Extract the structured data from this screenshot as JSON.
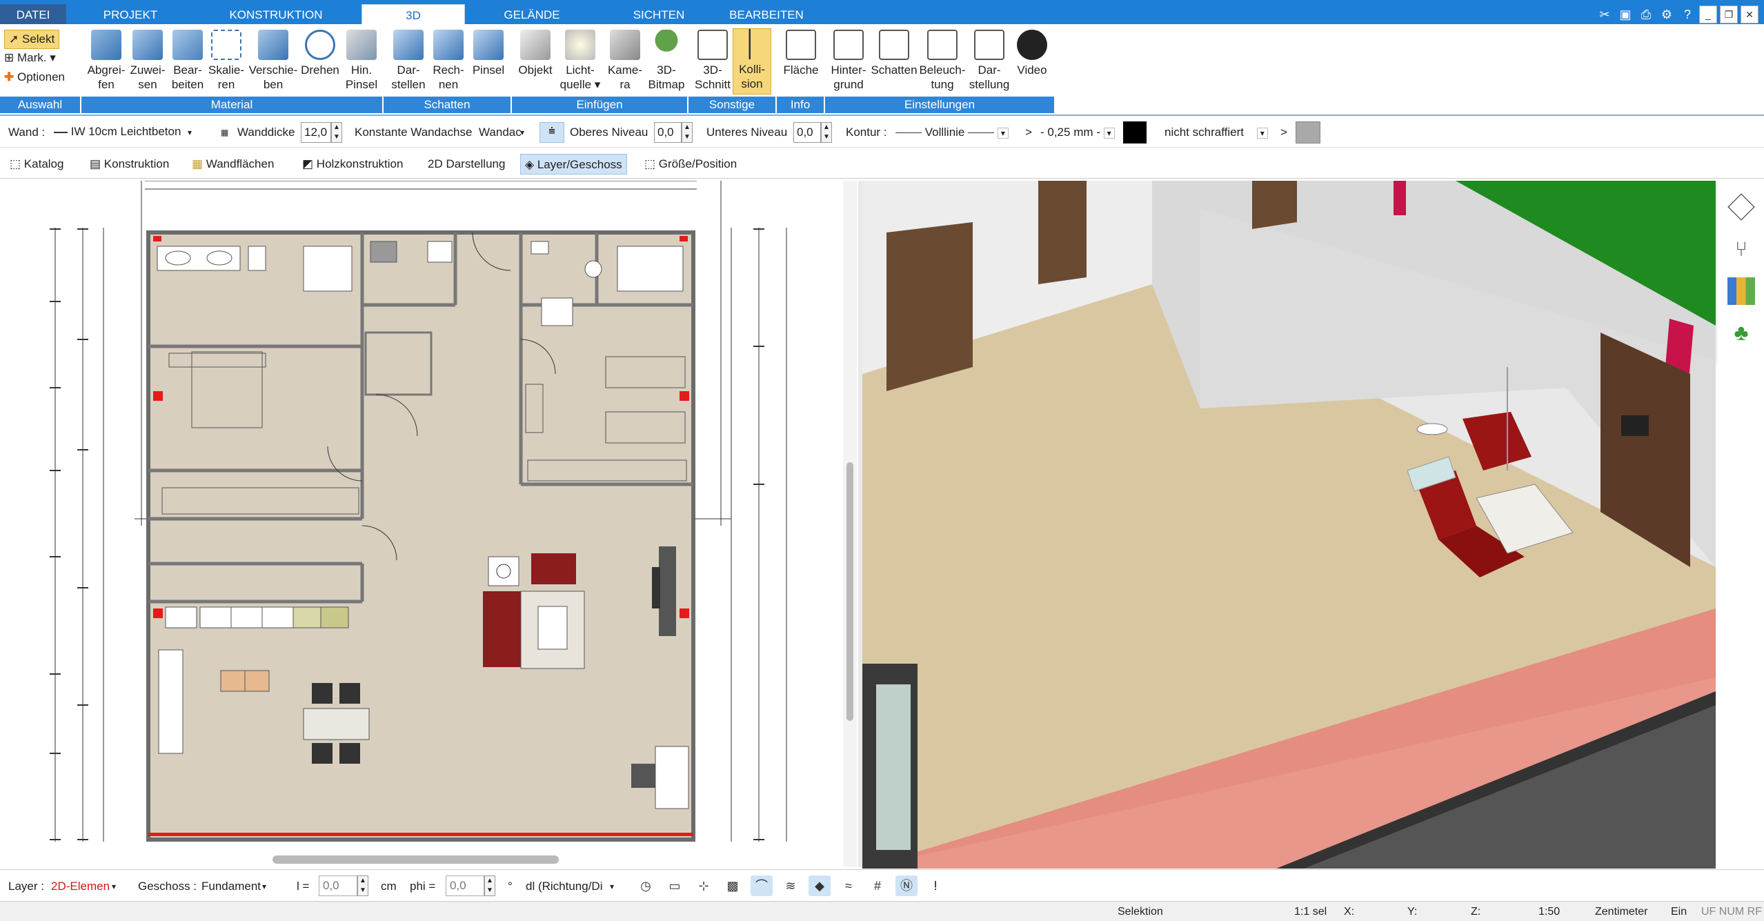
{
  "tabs": {
    "file": "DATEI",
    "items": [
      "PROJEKT",
      "KONSTRUKTION",
      "3D",
      "GELÄNDE",
      "SICHTEN",
      "BEARBEITEN"
    ],
    "active": "3D"
  },
  "window_buttons": [
    "_",
    "❐",
    "✕"
  ],
  "ribbon": {
    "auswahl": {
      "select": "Selekt",
      "mark": "Mark.",
      "options": "Optionen"
    },
    "buttons": [
      {
        "l1": "Abgrei-",
        "l2": "fen"
      },
      {
        "l1": "Zuwei-",
        "l2": "sen"
      },
      {
        "l1": "Bear-",
        "l2": "beiten"
      },
      {
        "l1": "Skalie-",
        "l2": "ren"
      },
      {
        "l1": "Verschie-",
        "l2": "ben"
      },
      {
        "l1": "Drehen",
        "l2": ""
      },
      {
        "l1": "Hin.",
        "l2": "Pinsel"
      },
      {
        "l1": "Dar-",
        "l2": "stellen"
      },
      {
        "l1": "Rech-",
        "l2": "nen"
      },
      {
        "l1": "Pinsel",
        "l2": ""
      },
      {
        "l1": "Objekt",
        "l2": ""
      },
      {
        "l1": "Licht-",
        "l2": "quelle ▾"
      },
      {
        "l1": "Kame-",
        "l2": "ra"
      },
      {
        "l1": "3D-",
        "l2": "Bitmap"
      },
      {
        "l1": "3D-",
        "l2": "Schnitt"
      },
      {
        "l1": "Kolli-",
        "l2": "sion"
      },
      {
        "l1": "Fläche",
        "l2": ""
      },
      {
        "l1": "Hinter-",
        "l2": "grund"
      },
      {
        "l1": "Schatten",
        "l2": ""
      },
      {
        "l1": "Beleuch-",
        "l2": "tung"
      },
      {
        "l1": "Dar-",
        "l2": "stellung"
      },
      {
        "l1": "Video",
        "l2": ""
      }
    ],
    "groups": [
      "Auswahl",
      "Material",
      "Schatten",
      "Einfügen",
      "Sonstige",
      "Info",
      "Einstellungen"
    ]
  },
  "props": {
    "wand_label": "Wand :",
    "wand_value": "IW 10cm Leichtbeton",
    "wanddicke_label": "Wanddicke",
    "wanddicke_value": "12,0",
    "wandachse_label": "Konstante Wandachse",
    "wandachse_value": "Wandac",
    "oberes_label": "Oberes Niveau",
    "oberes_value": "0,0",
    "unteres_label": "Unteres Niveau",
    "unteres_value": "0,0",
    "kontur_label": "Kontur :",
    "kontur_value": "Volllinie",
    "gt1": ">",
    "stroke_value": "- 0,25 mm -",
    "hatch_value": "nicht schraffiert",
    "gt2": ">"
  },
  "tools2": [
    "Katalog",
    "Konstruktion",
    "Wandflächen",
    "Holzkonstruktion",
    "2D Darstellung",
    "Layer/Geschoss",
    "Größe/Position"
  ],
  "bottom": {
    "layer_label": "Layer :",
    "layer_value": "2D-Elemen",
    "geschoss_label": "Geschoss :",
    "geschoss_value": "Fundament",
    "l_label": "l =",
    "l_value": "0,0",
    "cm": "cm",
    "phi_label": "phi =",
    "phi_value": "0,0",
    "deg": "°",
    "dl_value": "dl (Richtung/Di"
  },
  "status": {
    "mode": "Selektion",
    "sel": "1:1 sel",
    "x": "X:",
    "y": "Y:",
    "z": "Z:",
    "scale": "1:50",
    "unit": "Zentimeter",
    "ein": "Ein",
    "flags": "UF NUM RF"
  },
  "colors": {
    "accent": "#1e7fd6",
    "group_bar": "#2f86d8",
    "active_tool": "#f6d77a",
    "floor": "#d8cfbf",
    "red_marker": "#e41b1b"
  },
  "icons": [
    "select-arrow-icon",
    "pipette-icon",
    "paint-roller-icon",
    "scale-icon",
    "move-icon",
    "rotate-icon",
    "brush-icon",
    "cube-icon",
    "lamp-icon",
    "camera-icon",
    "tree-icon",
    "section-icon",
    "collision-icon",
    "area-icon",
    "house-icon",
    "monitor-icon",
    "play-icon",
    "layers-icon",
    "chair-icon",
    "palette-icon"
  ]
}
